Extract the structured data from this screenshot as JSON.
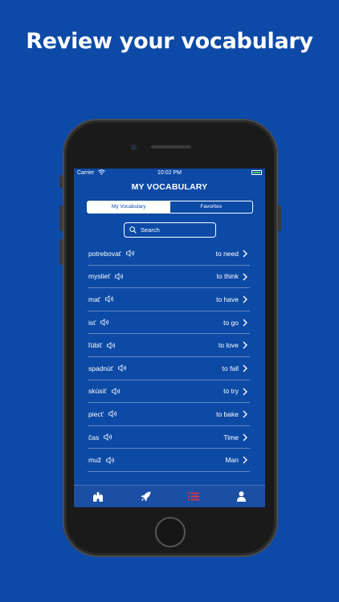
{
  "headline": "Review your vocabulary",
  "status": {
    "carrier": "Carrier",
    "time": "10:02 PM"
  },
  "title": "MY VOCABULARY",
  "segments": {
    "my_vocabulary": "My Vocabulary",
    "favorites": "Favorites"
  },
  "search": {
    "placeholder": "Search"
  },
  "words": [
    {
      "word": "potrebovať",
      "translation": "to need"
    },
    {
      "word": "myslieť",
      "translation": "to think"
    },
    {
      "word": "mať",
      "translation": "to have"
    },
    {
      "word": "isť",
      "translation": "to go"
    },
    {
      "word": "ľúbiť",
      "translation": "to love"
    },
    {
      "word": "spadnúť",
      "translation": "to fall"
    },
    {
      "word": "skúsiť",
      "translation": "to try"
    },
    {
      "word": "piecť",
      "translation": "to bake"
    },
    {
      "word": "čas",
      "translation": "Time"
    },
    {
      "word": "muž",
      "translation": "Man"
    }
  ],
  "tabs": [
    {
      "icon": "castle-icon",
      "active": false
    },
    {
      "icon": "rocket-icon",
      "active": false
    },
    {
      "icon": "list-icon",
      "active": true,
      "color": "#e0314b"
    },
    {
      "icon": "person-icon",
      "active": false
    }
  ]
}
